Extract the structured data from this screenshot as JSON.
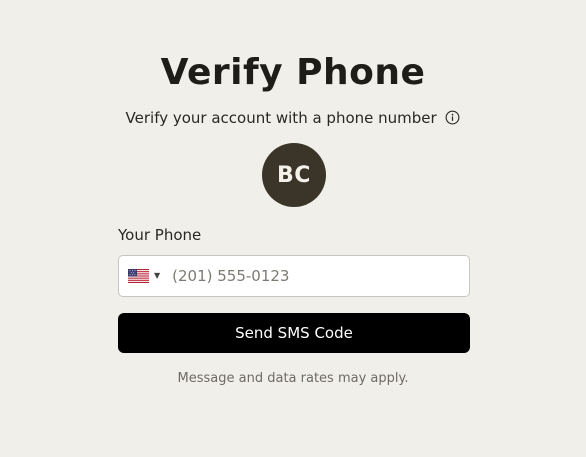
{
  "page": {
    "title": "Verify Phone",
    "subtitle": "Verify your account with a phone number",
    "subtitle_icon": "info-icon"
  },
  "avatar": {
    "initials": "BC",
    "background": "#3a3528"
  },
  "phone": {
    "label": "Your Phone",
    "country_flag": "us-flag-icon",
    "placeholder": "(201) 555-0123",
    "value": ""
  },
  "actions": {
    "send_label": "Send SMS Code"
  },
  "footer": {
    "disclaimer": "Message and data rates may apply."
  },
  "colors": {
    "background": "#f1efe9",
    "primary_button": "#000000",
    "text": "#1f1d1a"
  }
}
